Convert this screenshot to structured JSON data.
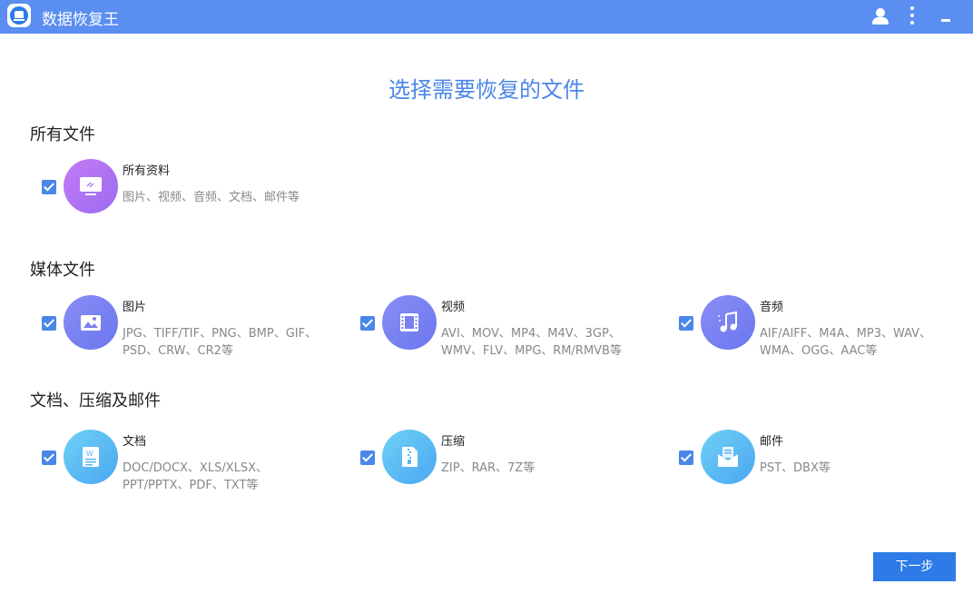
{
  "app": {
    "title": "数据恢复王"
  },
  "page": {
    "title": "选择需要恢复的文件"
  },
  "sections": [
    {
      "title": "所有文件",
      "items": [
        {
          "name": "所有资料",
          "desc": "图片、视频、音频、文档、邮件等",
          "icon": "all-files-icon",
          "checked": true
        }
      ]
    },
    {
      "title": "媒体文件",
      "items": [
        {
          "name": "图片",
          "desc": "JPG、TIFF/TIF、PNG、BMP、GIF、PSD、CRW、CR2等",
          "icon": "image-icon",
          "checked": true
        },
        {
          "name": "视频",
          "desc": "AVI、MOV、MP4、M4V、3GP、WMV、FLV、MPG、RM/RMVB等",
          "icon": "video-icon",
          "checked": true
        },
        {
          "name": "音频",
          "desc": "AIF/AIFF、M4A、MP3、WAV、WMA、OGG、AAC等",
          "icon": "music-icon",
          "checked": true
        }
      ]
    },
    {
      "title": "文档、压缩及邮件",
      "items": [
        {
          "name": "文档",
          "desc": "DOC/DOCX、XLS/XLSX、PPT/PPTX、PDF、TXT等",
          "icon": "document-icon",
          "checked": true
        },
        {
          "name": "压缩",
          "desc": "ZIP、RAR、7Z等",
          "icon": "archive-icon",
          "checked": true
        },
        {
          "name": "邮件",
          "desc": "PST、DBX等",
          "icon": "mail-icon",
          "checked": true
        }
      ]
    }
  ],
  "footer": {
    "next_label": "下一步"
  },
  "colors": {
    "titlebar": "#5a8ef0",
    "accent": "#4a86e8",
    "button": "#2e7be8"
  }
}
